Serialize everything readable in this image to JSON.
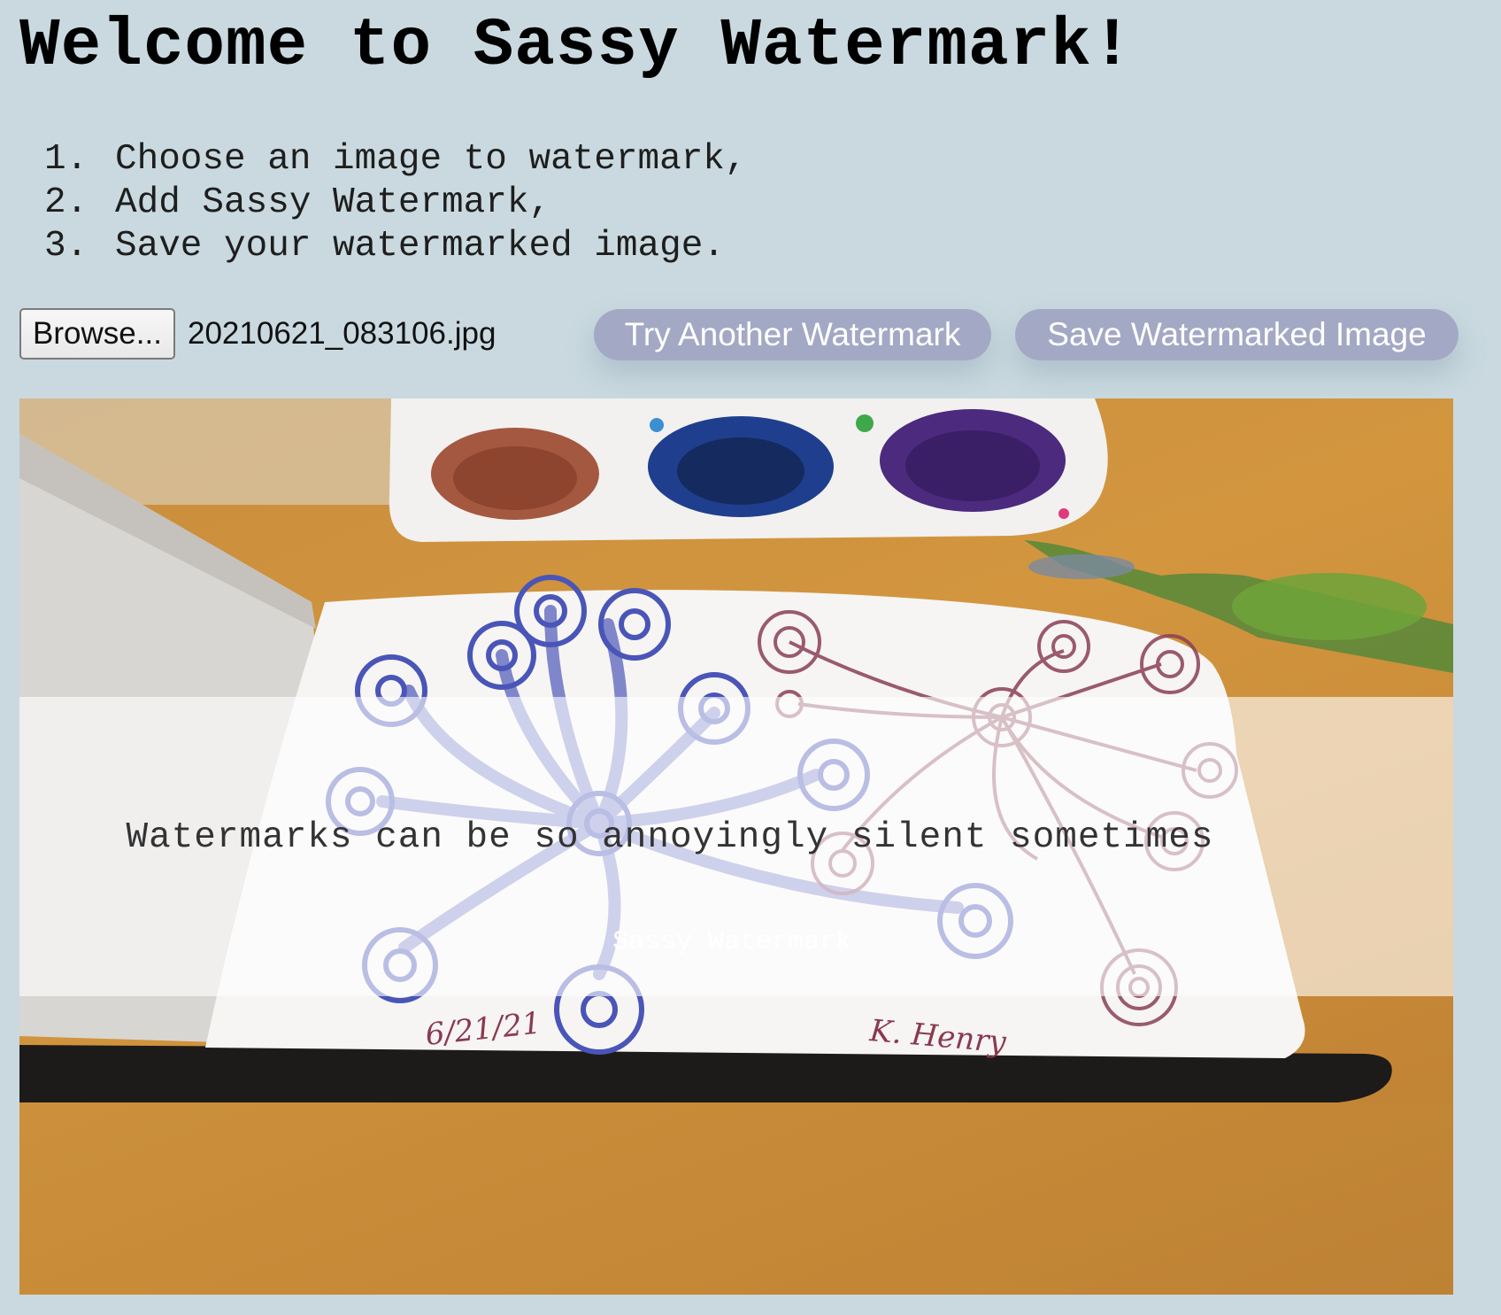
{
  "header": {
    "title": "Welcome to Sassy Watermark!"
  },
  "steps": [
    {
      "num": "1.",
      "text": "Choose an image to watermark,"
    },
    {
      "num": "2.",
      "text": "Add Sassy Watermark,"
    },
    {
      "num": "3.",
      "text": "Save your watermarked image."
    }
  ],
  "controls": {
    "browse_label": "Browse...",
    "filename": "20210621_083106.jpg",
    "try_another_label": "Try Another Watermark",
    "save_label": "Save Watermarked Image"
  },
  "image": {
    "watermark_text": "Watermarks can be so annoyingly silent sometimes",
    "brand_text": "Sassy Watermark",
    "date_inscription": "6/21/21",
    "signature": "K. Henry"
  },
  "colors": {
    "background": "#c9d9df",
    "button_pill": "#a3a9c4",
    "button_text": "#ffffff"
  }
}
